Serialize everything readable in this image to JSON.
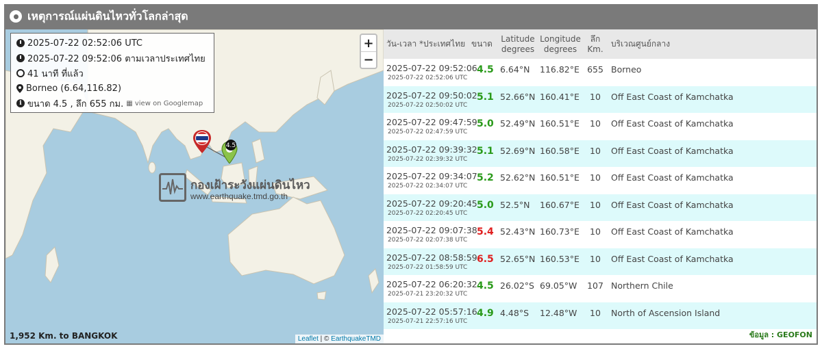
{
  "header": {
    "title": "เหตุการณ์แผ่นดินไหวทั่วโลกล่าสุด"
  },
  "map": {
    "zoom_in": "+",
    "zoom_out": "−",
    "info": {
      "utc_time": "2025-07-22 02:52:06 UTC",
      "thai_time": "2025-07-22 09:52:06 ตามเวลาประเทศไทย",
      "elapsed": "41 นาที ที่แล้ว",
      "location": "Borneo (6.64,116.82)",
      "magnitude_depth": "ขนาด 4.5 , ลึก 655 กม.",
      "gmap_link": "view on Googlemap"
    },
    "watermark": {
      "title": "กองเฝ้าระวังแผ่นดินไหว",
      "url": "www.earthquake.tmd.go.th"
    },
    "marker_label": "4.5",
    "distance": "1,952 Km. to BANGKOK",
    "attribution": {
      "leaflet": "Leaflet",
      "sep": " | © ",
      "owner": "EarthquakeTMD"
    }
  },
  "table": {
    "headers": {
      "datetime": "วัน-เวลา *ประเทศไทย",
      "magnitude": "ขนาด",
      "latitude": "Latitude",
      "latitude_unit": "degrees",
      "longitude": "Longitude",
      "longitude_unit": "degrees",
      "depth": "ลึก",
      "depth_unit": "Km.",
      "region": "บริเวณศูนย์กลาง"
    },
    "rows": [
      {
        "local": "2025-07-22 09:52:06",
        "utc": "2025-07-22 02:52:06 UTC",
        "mag": "4.5",
        "lat": "6.64°N",
        "lon": "116.82°E",
        "depth": "655",
        "region": "Borneo",
        "color": "#2a9a1a"
      },
      {
        "local": "2025-07-22 09:50:02",
        "utc": "2025-07-22 02:50:02 UTC",
        "mag": "5.1",
        "lat": "52.66°N",
        "lon": "160.41°E",
        "depth": "10",
        "region": "Off East Coast of Kamchatka",
        "color": "#2a9a1a"
      },
      {
        "local": "2025-07-22 09:47:59",
        "utc": "2025-07-22 02:47:59 UTC",
        "mag": "5.0",
        "lat": "52.49°N",
        "lon": "160.51°E",
        "depth": "10",
        "region": "Off East Coast of Kamchatka",
        "color": "#2a9a1a"
      },
      {
        "local": "2025-07-22 09:39:32",
        "utc": "2025-07-22 02:39:32 UTC",
        "mag": "5.1",
        "lat": "52.69°N",
        "lon": "160.58°E",
        "depth": "10",
        "region": "Off East Coast of Kamchatka",
        "color": "#2a9a1a"
      },
      {
        "local": "2025-07-22 09:34:07",
        "utc": "2025-07-22 02:34:07 UTC",
        "mag": "5.2",
        "lat": "52.62°N",
        "lon": "160.51°E",
        "depth": "10",
        "region": "Off East Coast of Kamchatka",
        "color": "#2a9a1a"
      },
      {
        "local": "2025-07-22 09:20:45",
        "utc": "2025-07-22 02:20:45 UTC",
        "mag": "5.0",
        "lat": "52.5°N",
        "lon": "160.67°E",
        "depth": "10",
        "region": "Off East Coast of Kamchatka",
        "color": "#2a9a1a"
      },
      {
        "local": "2025-07-22 09:07:38",
        "utc": "2025-07-22 02:07:38 UTC",
        "mag": "5.4",
        "lat": "52.43°N",
        "lon": "160.73°E",
        "depth": "10",
        "region": "Off East Coast of Kamchatka",
        "color": "#e02020"
      },
      {
        "local": "2025-07-22 08:58:59",
        "utc": "2025-07-22 01:58:59 UTC",
        "mag": "6.5",
        "lat": "52.65°N",
        "lon": "160.53°E",
        "depth": "10",
        "region": "Off East Coast of Kamchatka",
        "color": "#e02020"
      },
      {
        "local": "2025-07-22 06:20:32",
        "utc": "2025-07-21 23:20:32 UTC",
        "mag": "4.5",
        "lat": "26.02°S",
        "lon": "69.05°W",
        "depth": "107",
        "region": "Northern Chile",
        "color": "#2a9a1a"
      },
      {
        "local": "2025-07-22 05:57:16",
        "utc": "2025-07-21 22:57:16 UTC",
        "mag": "4.9",
        "lat": "4.48°S",
        "lon": "12.48°W",
        "depth": "10",
        "region": "North of Ascension Island",
        "color": "#2a9a1a"
      }
    ],
    "source": "ข้อมูล : GEOFON"
  }
}
